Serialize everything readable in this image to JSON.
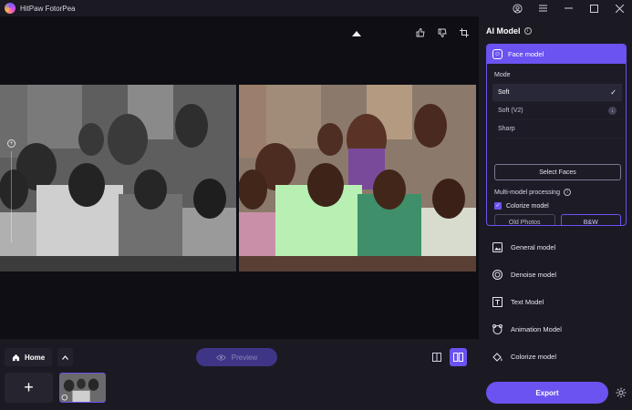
{
  "app": {
    "title": "HitPaw FotorPea"
  },
  "window_controls": {
    "account_icon": "user-circle-icon",
    "menu_icon": "hamburger-icon",
    "minimize_icon": "minimize-icon",
    "maximize_icon": "maximize-icon",
    "close_icon": "close-icon"
  },
  "canvas": {
    "icons": [
      "thumbs-up-icon",
      "thumbs-down-icon",
      "crop-icon"
    ]
  },
  "bottom_bar": {
    "home_label": "Home",
    "preview_label": "Preview",
    "add_label": "+"
  },
  "right_panel": {
    "title": "AI Model",
    "face_model": {
      "label": "Face model",
      "mode_label": "Mode",
      "modes": [
        {
          "label": "Soft",
          "selected": true
        },
        {
          "label": "Soft (V2)",
          "selected": false
        },
        {
          "label": "Sharp",
          "selected": false
        }
      ],
      "select_faces_label": "Select Faces",
      "multi_model_label": "Multi-model processing",
      "colorize_label": "Colorize model",
      "colorize_checked": true,
      "options": [
        "Old Photos",
        "B&W"
      ],
      "active_option": "B&W"
    },
    "models": [
      {
        "label": "General model",
        "icon": "image-icon"
      },
      {
        "label": "Denoise model",
        "icon": "denoise-icon"
      },
      {
        "label": "Text Model",
        "icon": "text-icon"
      },
      {
        "label": "Animation Model",
        "icon": "animation-icon"
      },
      {
        "label": "Colorize model",
        "icon": "paint-bucket-icon"
      }
    ],
    "export_label": "Export"
  },
  "colors": {
    "accent": "#6a53f0",
    "background": "#18171f",
    "panel": "#1b1a22"
  }
}
